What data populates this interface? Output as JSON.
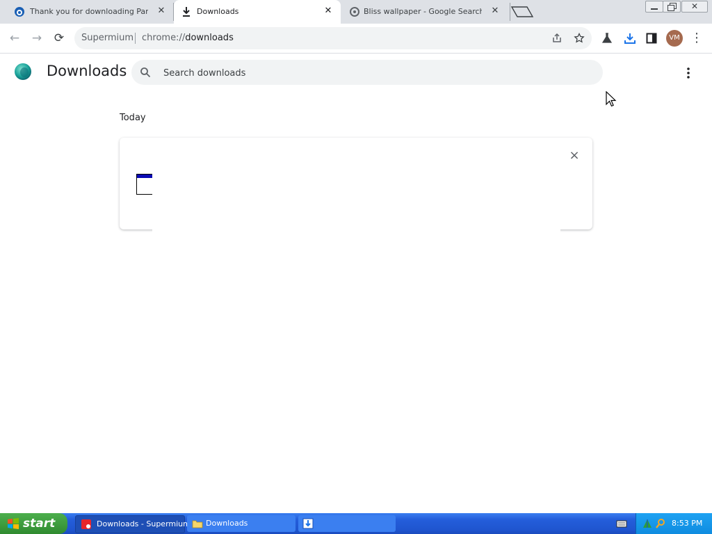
{
  "browser": {
    "tabs": [
      {
        "title": "Thank you for downloading Panda ...",
        "icon": "panda-icon"
      },
      {
        "title": "Downloads",
        "icon": "download-icon",
        "active": true
      },
      {
        "title": "Bliss wallpaper - Google Search",
        "icon": "google-icon"
      }
    ],
    "omnibox": {
      "scheme": "Supermium",
      "url_prefix": "chrome://",
      "url_host": "downloads"
    },
    "avatar_initials": "VM"
  },
  "page": {
    "title": "Downloads",
    "search_placeholder": "Search downloads",
    "section_date": "Today",
    "card_close": "×"
  },
  "taskbar": {
    "start_label": "start",
    "items": [
      {
        "label": "Downloads - Supermium"
      },
      {
        "label": "Downloads"
      },
      {
        "label": ""
      }
    ],
    "clock": "8:53 PM"
  },
  "colors": {
    "accent": "#1a73e8",
    "taskbar": "#245edb",
    "start": "#3c9a3c",
    "tray": "#0f8ce0"
  }
}
